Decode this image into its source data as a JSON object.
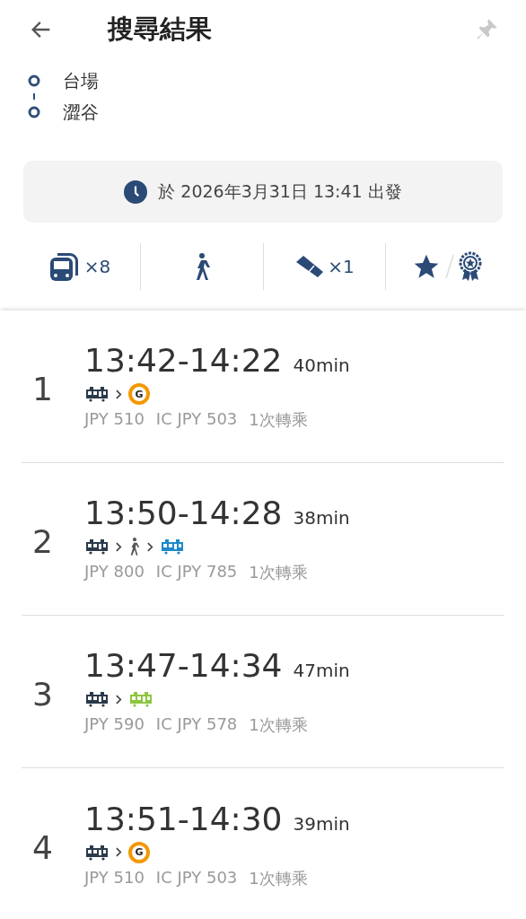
{
  "header": {
    "title": "搜尋結果"
  },
  "route": {
    "stops": [
      "台場",
      "澀谷"
    ]
  },
  "departure": {
    "text": "於 2026年3月31日 13:41 出發"
  },
  "filters": [
    {
      "kind": "transit",
      "count": "×8"
    },
    {
      "kind": "walk"
    },
    {
      "kind": "ticket",
      "count": "×1"
    },
    {
      "kind": "favorite"
    }
  ],
  "results": [
    {
      "index": "1",
      "time": "13:42-14:22",
      "duration": "40min",
      "legs": [
        {
          "kind": "train",
          "color": "#2b3a4a"
        },
        {
          "kind": "line",
          "letter": "G",
          "color": "#f39800"
        }
      ],
      "fare": "JPY 510",
      "ic_fare": "IC JPY 503",
      "transfers": "1次轉乘"
    },
    {
      "index": "2",
      "time": "13:50-14:28",
      "duration": "38min",
      "legs": [
        {
          "kind": "train",
          "color": "#2b3a4a"
        },
        {
          "kind": "walk"
        },
        {
          "kind": "train",
          "color": "#1e88c8"
        }
      ],
      "fare": "JPY 800",
      "ic_fare": "IC JPY 785",
      "transfers": "1次轉乘"
    },
    {
      "index": "3",
      "time": "13:47-14:34",
      "duration": "47min",
      "legs": [
        {
          "kind": "train",
          "color": "#2b3a4a"
        },
        {
          "kind": "train",
          "color": "#8cc63f"
        }
      ],
      "fare": "JPY 590",
      "ic_fare": "IC JPY 578",
      "transfers": "1次轉乘"
    },
    {
      "index": "4",
      "time": "13:51-14:30",
      "duration": "39min",
      "legs": [
        {
          "kind": "train",
          "color": "#2b3a4a"
        },
        {
          "kind": "line",
          "letter": "G",
          "color": "#f39800"
        }
      ],
      "fare": "JPY 510",
      "ic_fare": "IC JPY 503",
      "transfers": "1次轉乘"
    }
  ]
}
